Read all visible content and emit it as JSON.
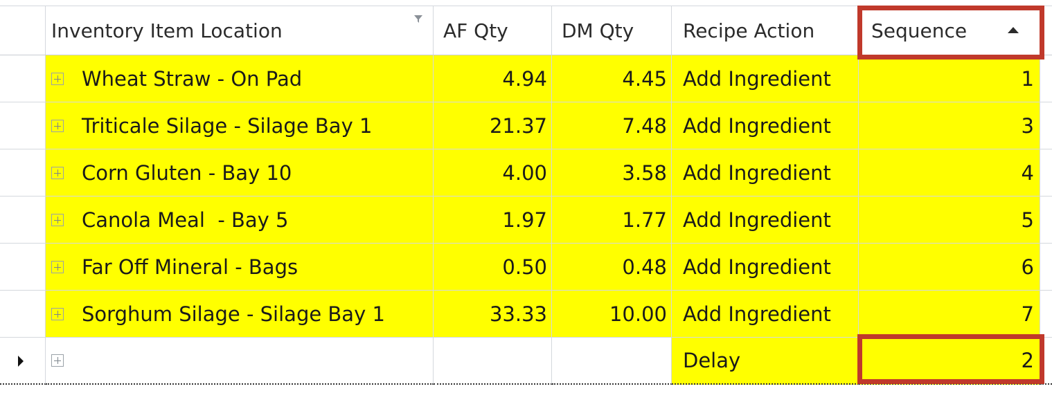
{
  "columns": {
    "location": "Inventory Item Location",
    "af_qty": "AF Qty",
    "dm_qty": "DM Qty",
    "recipe_action": "Recipe Action",
    "sequence": "Sequence"
  },
  "icons": {
    "filter": "filter-icon",
    "sort": "sort-ascending-icon",
    "expand": "expand-plus-icon",
    "row_pointer": "current-row-indicator-icon"
  },
  "colors": {
    "row_highlight": "#ffff00",
    "callout_border": "#c0392b"
  },
  "rows": [
    {
      "location": "Wheat Straw - On Pad",
      "af_qty": "4.94",
      "dm_qty": "4.45",
      "recipe_action": "Add Ingredient",
      "sequence": "1"
    },
    {
      "location": "Triticale Silage - Silage Bay 1",
      "af_qty": "21.37",
      "dm_qty": "7.48",
      "recipe_action": "Add Ingredient",
      "sequence": "3"
    },
    {
      "location": "Corn Gluten - Bay 10",
      "af_qty": "4.00",
      "dm_qty": "3.58",
      "recipe_action": "Add Ingredient",
      "sequence": "4"
    },
    {
      "location": "Canola Meal  - Bay 5",
      "af_qty": "1.97",
      "dm_qty": "1.77",
      "recipe_action": "Add Ingredient",
      "sequence": "5"
    },
    {
      "location": "Far Off Mineral - Bags",
      "af_qty": "0.50",
      "dm_qty": "0.48",
      "recipe_action": "Add Ingredient",
      "sequence": "6"
    },
    {
      "location": "Sorghum Silage - Silage Bay 1",
      "af_qty": "33.33",
      "dm_qty": "10.00",
      "recipe_action": "Add Ingredient",
      "sequence": "7"
    }
  ],
  "current_row": {
    "location": "",
    "af_qty": "",
    "dm_qty": "",
    "recipe_action": "Delay",
    "sequence": "2"
  }
}
